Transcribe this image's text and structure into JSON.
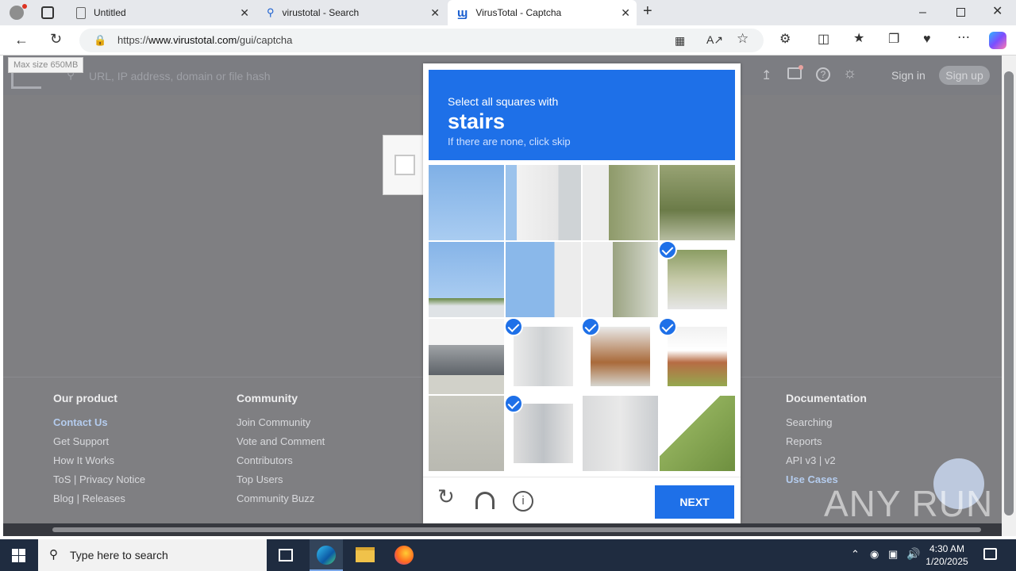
{
  "browser": {
    "tabs": [
      {
        "label": "Untitled"
      },
      {
        "label": "virustotal - Search"
      },
      {
        "label": "VirusTotal - Captcha"
      }
    ],
    "url_prefix": "https://",
    "url_domain": "www.virustotal.com",
    "url_path": "/gui/captcha"
  },
  "vt": {
    "tooltip": "Max size 650MB",
    "search_placeholder": "URL, IP address, domain or file hash",
    "sign_in": "Sign in",
    "sign_up": "Sign up"
  },
  "footer": {
    "col1": {
      "title": "Our product",
      "items": [
        "Contact Us",
        "Get Support",
        "How It Works",
        "ToS | Privacy Notice",
        "Blog | Releases"
      ]
    },
    "col2": {
      "title": "Community",
      "items": [
        "Join Community",
        "Vote and Comment",
        "Contributors",
        "Top Users",
        "Community Buzz"
      ]
    },
    "col5": {
      "title": "Documentation",
      "items": [
        "Searching",
        "Reports",
        "API v3 | v2",
        "Use Cases"
      ]
    }
  },
  "captcha": {
    "prompt": "Select all squares with",
    "target": "stairs",
    "hint": "If there are none, click skip",
    "next_label": "NEXT",
    "selected": [
      7,
      9,
      10,
      11,
      13
    ]
  },
  "taskbar": {
    "search_placeholder": "Type here to search",
    "time": "4:30 AM",
    "date": "1/20/2025"
  },
  "watermark": "ANY RUN",
  "colors": {
    "accent": "#1e70e8",
    "taskbar": "#1f2c40"
  }
}
